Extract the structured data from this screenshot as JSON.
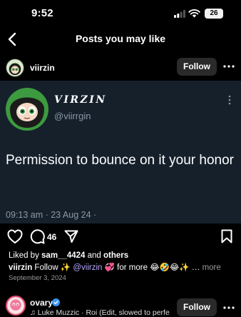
{
  "status_bar": {
    "time": "9:52",
    "battery": "26"
  },
  "nav": {
    "title": "Posts you may like"
  },
  "post": {
    "username": "viirzin",
    "follow_label": "Follow",
    "tweet": {
      "display_name": "VIRZIN",
      "handle": "@viirrgin",
      "text": "Permission to bounce on it your honor",
      "meta": "09:13 am · 23 Aug 24 ·"
    },
    "comment_count": "46",
    "liked_by": {
      "prefix": "Liked by ",
      "user": "sam__4424",
      "middle": " and ",
      "suffix": "others"
    },
    "caption": {
      "username": "viirzin",
      "part1": " Follow ✨ ",
      "mention": "@viirzin",
      "part2": " 💞 for more 😂🤣😂✨ … ",
      "more_label": "more"
    },
    "date": "September 3, 2024"
  },
  "next_post": {
    "username": "ovary",
    "audio": "♫ Luke Muzzic · Roi (Edit, slowed to perfe",
    "follow_label": "Follow"
  },
  "colors": {
    "background": "#000000",
    "tweet_bg": "#15202b",
    "mention": "#b6a9ff",
    "muted": "#8b98a5"
  },
  "icons": [
    "back-chevron-icon",
    "heart-icon",
    "comment-icon",
    "share-icon",
    "bookmark-icon",
    "more-icon",
    "verified-icon",
    "signal-icon",
    "wifi-icon",
    "battery-icon"
  ]
}
